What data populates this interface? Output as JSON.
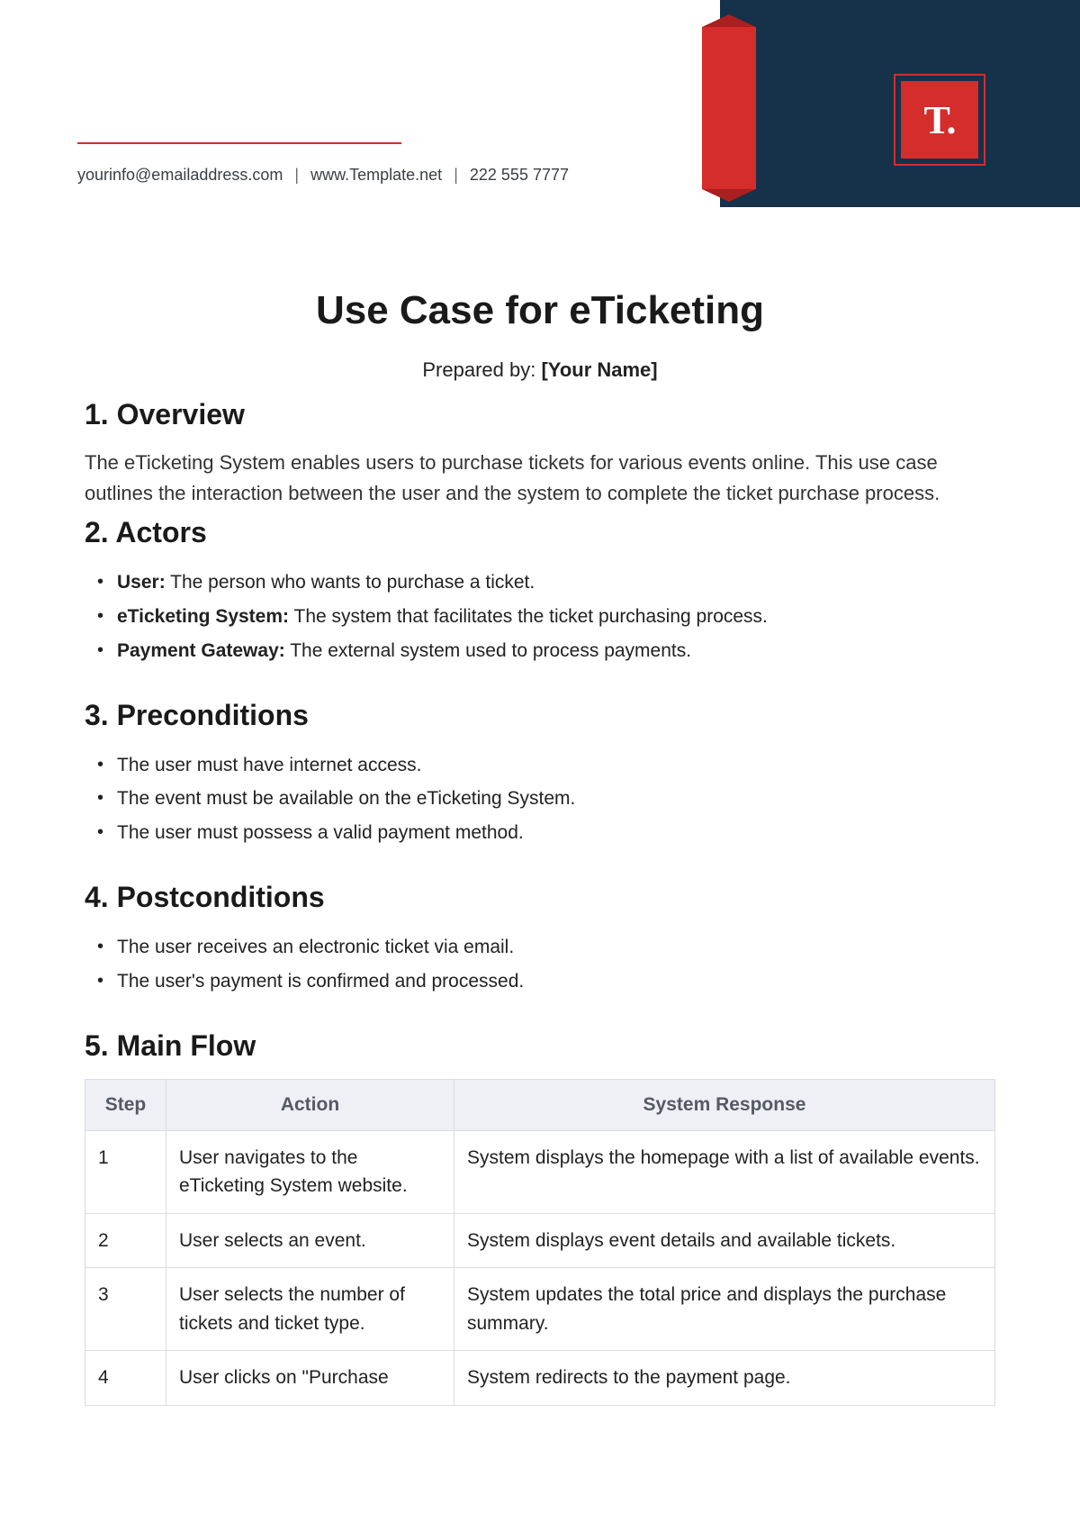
{
  "header": {
    "logo_text": "T.",
    "email": "yourinfo@emailaddress.com",
    "website": "www.Template.net",
    "phone": "222 555 7777"
  },
  "doc": {
    "title": "Use Case for eTicketing",
    "prepared_label": "Prepared by:",
    "prepared_value": "[Your Name]"
  },
  "sections": {
    "overview": {
      "heading": "1. Overview",
      "body": "The eTicketing System enables users to purchase tickets for various events online. This use case outlines the interaction between the user and the system to complete the ticket purchase process."
    },
    "actors": {
      "heading": "2. Actors",
      "items": [
        {
          "term": "User:",
          "desc": " The person who wants to purchase a ticket."
        },
        {
          "term": "eTicketing System:",
          "desc": " The system that facilitates the ticket purchasing process."
        },
        {
          "term": "Payment Gateway:",
          "desc": " The external system used to process payments."
        }
      ]
    },
    "preconditions": {
      "heading": "3. Preconditions",
      "items": [
        "The user must have internet access.",
        "The event must be available on the eTicketing System.",
        "The user must possess a valid payment method."
      ]
    },
    "postconditions": {
      "heading": "4. Postconditions",
      "items": [
        "The user receives an electronic ticket via email.",
        "The user's payment is confirmed and processed."
      ]
    },
    "mainflow": {
      "heading": "5. Main Flow",
      "columns": {
        "step": "Step",
        "action": "Action",
        "response": "System Response"
      },
      "rows": [
        {
          "step": "1",
          "action": "User navigates to the eTicketing System website.",
          "response": "System displays the homepage with a list of available events."
        },
        {
          "step": "2",
          "action": "User selects an event.",
          "response": "System displays event details and available tickets."
        },
        {
          "step": "3",
          "action": "User selects the number of tickets and ticket type.",
          "response": "System updates the total price and displays the purchase summary."
        },
        {
          "step": "4",
          "action": "User clicks on \"Purchase",
          "response": "System redirects to the payment page."
        }
      ]
    }
  }
}
